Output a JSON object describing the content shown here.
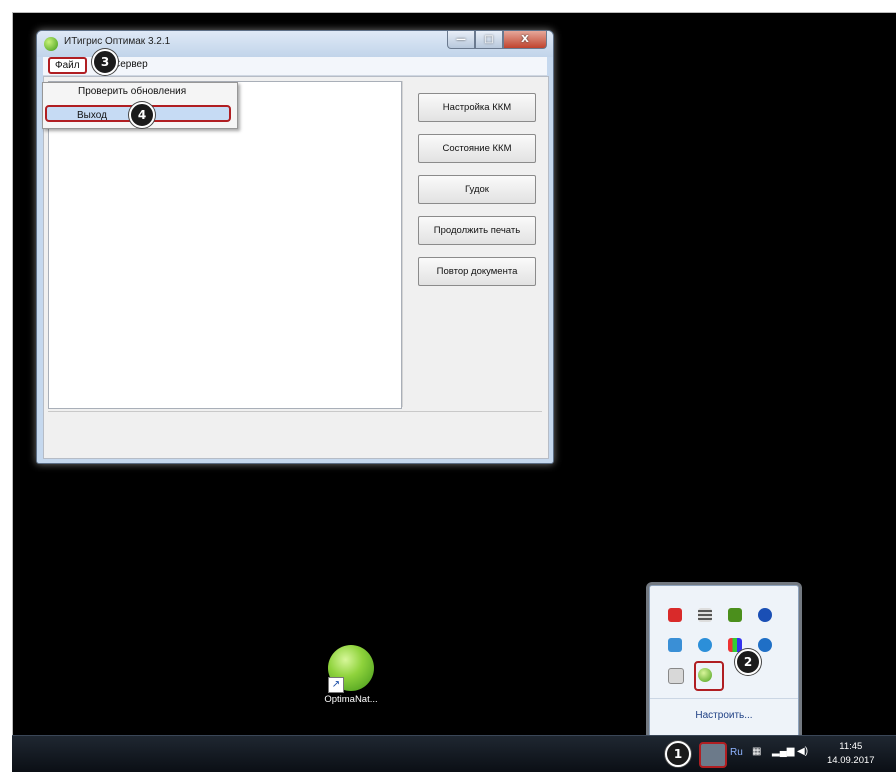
{
  "window": {
    "title": "ИТигрис Оптимак 3.2.1",
    "controls": {
      "minimize": "—",
      "maximize": "□",
      "close": "X"
    }
  },
  "menu": {
    "file": "Файл",
    "service": "Сервер",
    "file_items": [
      {
        "label": "Проверить обновления"
      },
      {
        "label": "Выход"
      }
    ]
  },
  "buttons": [
    {
      "label": "Настройка ККМ"
    },
    {
      "label": "Состояние ККМ"
    },
    {
      "label": "Гудок"
    },
    {
      "label": "Продолжить печать"
    },
    {
      "label": "Повтор документа"
    }
  ],
  "callouts": [
    "1",
    "2",
    "3",
    "4"
  ],
  "desktop": {
    "icon_label": "OptimaNat...",
    "icon_name": "optima-app-icon"
  },
  "tray_popup": {
    "customize_link": "Настроить...",
    "icons": [
      "red-app-icon",
      "list-icon",
      "nvidia-icon",
      "bluetooth-icon",
      "flag-icon",
      "edge-icon",
      "colors-icon",
      "disk-icon",
      "usb-icon",
      "optima-tray-icon"
    ]
  },
  "taskbar": {
    "language": "Ru",
    "time": "11:45",
    "date": "14.09.2017"
  },
  "colors": {
    "highlight": "#b01e22",
    "desktop": "#000000",
    "selection": "#c6dbf4"
  }
}
